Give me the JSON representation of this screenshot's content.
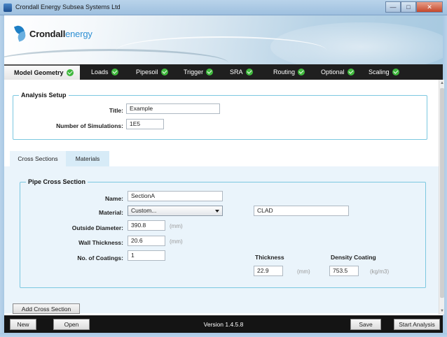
{
  "window": {
    "title": "Crondall Energy Subsea Systems Ltd"
  },
  "logo": {
    "brand_bold": "Crondall",
    "brand_light": "energy"
  },
  "tabs": [
    {
      "label": "Model Geometry",
      "active": true
    },
    {
      "label": "Loads"
    },
    {
      "label": "Pipesoil"
    },
    {
      "label": "Trigger"
    },
    {
      "label": "SRA"
    },
    {
      "label": "Routing"
    },
    {
      "label": "Optional"
    },
    {
      "label": "Scaling"
    }
  ],
  "analysis_setup": {
    "legend": "Analysis Setup",
    "title_label": "Title:",
    "title_value": "Example",
    "num_sims_label": "Number of Simulations:",
    "num_sims_value": "1E5"
  },
  "subtabs": [
    {
      "label": "Cross Sections",
      "active": true
    },
    {
      "label": "Materials"
    }
  ],
  "pipe_cross_section": {
    "legend": "Pipe Cross Section",
    "name_label": "Name:",
    "name_value": "SectionA",
    "material_label": "Material:",
    "material_value": "Custom...",
    "coating_name_value": "CLAD",
    "od_label": "Outside Diameter:",
    "od_value": "390.8",
    "od_unit": "(mm)",
    "wt_label": "Wall Thickness:",
    "wt_value": "20.6",
    "wt_unit": "(mm)",
    "coatings_label": "No. of Coatings:",
    "coatings_value": "1",
    "thickness_header": "Thickness",
    "thickness_value": "22.9",
    "thickness_unit": "(mm)",
    "density_header": "Density Coating",
    "density_value": "753.5",
    "density_unit": "(kg/m3)"
  },
  "add_cross_section_label": "Add Cross Section",
  "footer": {
    "new_label": "New",
    "open_label": "Open",
    "version": "Version 1.4.5.8",
    "save_label": "Save",
    "start_label": "Start Analysis"
  },
  "colors": {
    "tab_bar": "#1f1f1f",
    "check": "#3fb83c",
    "group_border": "#7cc8e0",
    "panel": "#eaf4fb"
  }
}
